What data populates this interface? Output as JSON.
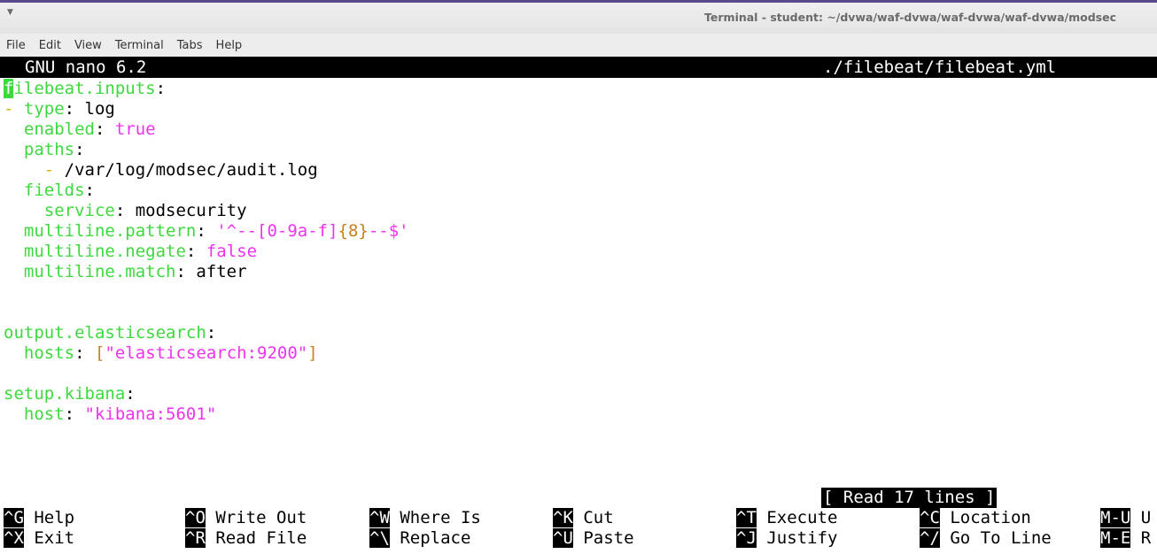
{
  "window": {
    "title": "Terminal - student: ~/dvwa/waf-dvwa/waf-dvwa/waf-dvwa/modsec",
    "menu_glyph": "▼"
  },
  "menubar": [
    "File",
    "Edit",
    "View",
    "Terminal",
    "Tabs",
    "Help"
  ],
  "nano": {
    "version": "GNU nano 6.2",
    "filename": "./filebeat/filebeat.yml",
    "status": "[ Read 17 lines ]"
  },
  "lines": [
    {
      "segments": [
        [
          "cursor",
          "f"
        ],
        [
          "k",
          "ilebeat.inputs"
        ],
        [
          "t",
          ":"
        ]
      ]
    },
    {
      "segments": [
        [
          "d",
          "-"
        ],
        [
          "t",
          " "
        ],
        [
          "k",
          "type"
        ],
        [
          "t",
          ": log"
        ]
      ]
    },
    {
      "segments": [
        [
          "t",
          "  "
        ],
        [
          "k",
          "enabled"
        ],
        [
          "t",
          ": "
        ],
        [
          "v",
          "true"
        ]
      ]
    },
    {
      "segments": [
        [
          "t",
          "  "
        ],
        [
          "k",
          "paths"
        ],
        [
          "t",
          ":"
        ]
      ]
    },
    {
      "segments": [
        [
          "t",
          "    "
        ],
        [
          "d",
          "-"
        ],
        [
          "t",
          " /var/log/modsec/audit.log"
        ]
      ]
    },
    {
      "segments": [
        [
          "t",
          "  "
        ],
        [
          "k",
          "fields"
        ],
        [
          "t",
          ":"
        ]
      ]
    },
    {
      "segments": [
        [
          "t",
          "    "
        ],
        [
          "k",
          "service"
        ],
        [
          "t",
          ": modsecurity"
        ]
      ]
    },
    {
      "segments": [
        [
          "t",
          "  "
        ],
        [
          "k",
          "multiline.pattern"
        ],
        [
          "t",
          ": "
        ],
        [
          "v",
          "'^--[0-9a-f]"
        ],
        [
          "b",
          "{8}"
        ],
        [
          "v",
          "--$'"
        ]
      ]
    },
    {
      "segments": [
        [
          "t",
          "  "
        ],
        [
          "k",
          "multiline.negate"
        ],
        [
          "t",
          ": "
        ],
        [
          "v",
          "false"
        ]
      ]
    },
    {
      "segments": [
        [
          "t",
          "  "
        ],
        [
          "k",
          "multiline.match"
        ],
        [
          "t",
          ": after"
        ]
      ]
    },
    {
      "segments": []
    },
    {
      "segments": []
    },
    {
      "segments": [
        [
          "k",
          "output.elasticsearch"
        ],
        [
          "t",
          ":"
        ]
      ]
    },
    {
      "segments": [
        [
          "t",
          "  "
        ],
        [
          "k",
          "hosts"
        ],
        [
          "t",
          ": "
        ],
        [
          "b",
          "["
        ],
        [
          "v",
          "\"elasticsearch:9200\""
        ],
        [
          "b",
          "]"
        ]
      ]
    },
    {
      "segments": []
    },
    {
      "segments": [
        [
          "k",
          "setup.kibana"
        ],
        [
          "t",
          ":"
        ]
      ]
    },
    {
      "segments": [
        [
          "t",
          "  "
        ],
        [
          "k",
          "host"
        ],
        [
          "t",
          ": "
        ],
        [
          "v",
          "\"kibana:5601\""
        ]
      ]
    }
  ],
  "shortcuts": [
    [
      {
        "key": "^G",
        "label": "Help"
      },
      {
        "key": "^O",
        "label": "Write Out"
      },
      {
        "key": "^W",
        "label": "Where Is"
      },
      {
        "key": "^K",
        "label": "Cut"
      },
      {
        "key": "^T",
        "label": "Execute"
      },
      {
        "key": "^C",
        "label": "Location"
      },
      {
        "key": "M-U",
        "label": "U"
      }
    ],
    [
      {
        "key": "^X",
        "label": "Exit"
      },
      {
        "key": "^R",
        "label": "Read File"
      },
      {
        "key": "^\\",
        "label": "Replace"
      },
      {
        "key": "^U",
        "label": "Paste"
      },
      {
        "key": "^J",
        "label": "Justify"
      },
      {
        "key": "^/",
        "label": "Go To Line"
      },
      {
        "key": "M-E",
        "label": "R"
      }
    ]
  ]
}
